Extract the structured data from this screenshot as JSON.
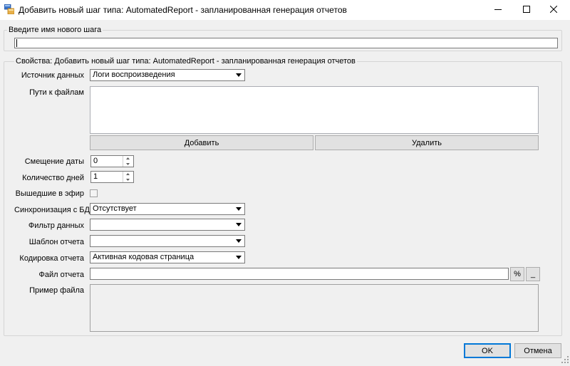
{
  "window": {
    "title": "Добавить новый шаг типа: AutomatedReport - запланированная генерация отчетов",
    "minimize_icon": "minimize-icon",
    "maximize_icon": "maximize-icon",
    "close_icon": "close-icon"
  },
  "step_name_group": {
    "legend": "Введите имя нового шага",
    "value": ""
  },
  "properties_group": {
    "legend": "Свойства: Добавить новый шаг типа: AutomatedReport - запланированная генерация отчетов",
    "data_source": {
      "label": "Источник данных",
      "value": "Логи воспроизведения"
    },
    "file_paths": {
      "label": "Пути к файлам",
      "value": ""
    },
    "add_button": "Добавить",
    "delete_button": "Удалить",
    "date_offset": {
      "label": "Смещение даты",
      "value": "0"
    },
    "days_count": {
      "label": "Количество дней",
      "value": "1"
    },
    "aired": {
      "label": "Вышедшие в эфир",
      "checked": false
    },
    "db_sync": {
      "label": "Синхронизация с БД",
      "value": "Отсутствует"
    },
    "data_filter": {
      "label": "Фильтр данных",
      "value": ""
    },
    "report_template": {
      "label": "Шаблон отчета",
      "value": ""
    },
    "report_encoding": {
      "label": "Кодировка отчета",
      "value": "Активная кодовая страница"
    },
    "report_file": {
      "label": "Файл отчета",
      "value": "",
      "percent_button": "%",
      "browse_button": "_"
    },
    "file_example": {
      "label": "Пример файла",
      "value": ""
    }
  },
  "footer": {
    "ok_button": "OK",
    "cancel_button": "Отмена"
  }
}
